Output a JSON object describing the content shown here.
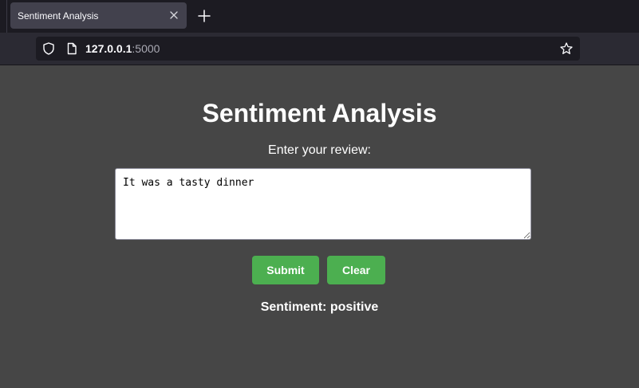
{
  "browser": {
    "tab_title": "Sentiment Analysis",
    "url_host": "127.0.0.1",
    "url_port": ":5000",
    "icons": [
      "shield-icon",
      "page-icon",
      "star-icon",
      "close-icon",
      "plus-icon"
    ]
  },
  "page": {
    "title": "Sentiment Analysis",
    "review_label": "Enter your review:",
    "review_value": "It was a tasty dinner",
    "submit_label": "Submit",
    "clear_label": "Clear",
    "result_prefix": "Sentiment: ",
    "result_value": "positive"
  },
  "colors": {
    "page_background": "#464646",
    "button_background": "#4caf50",
    "text": "#ffffff"
  }
}
